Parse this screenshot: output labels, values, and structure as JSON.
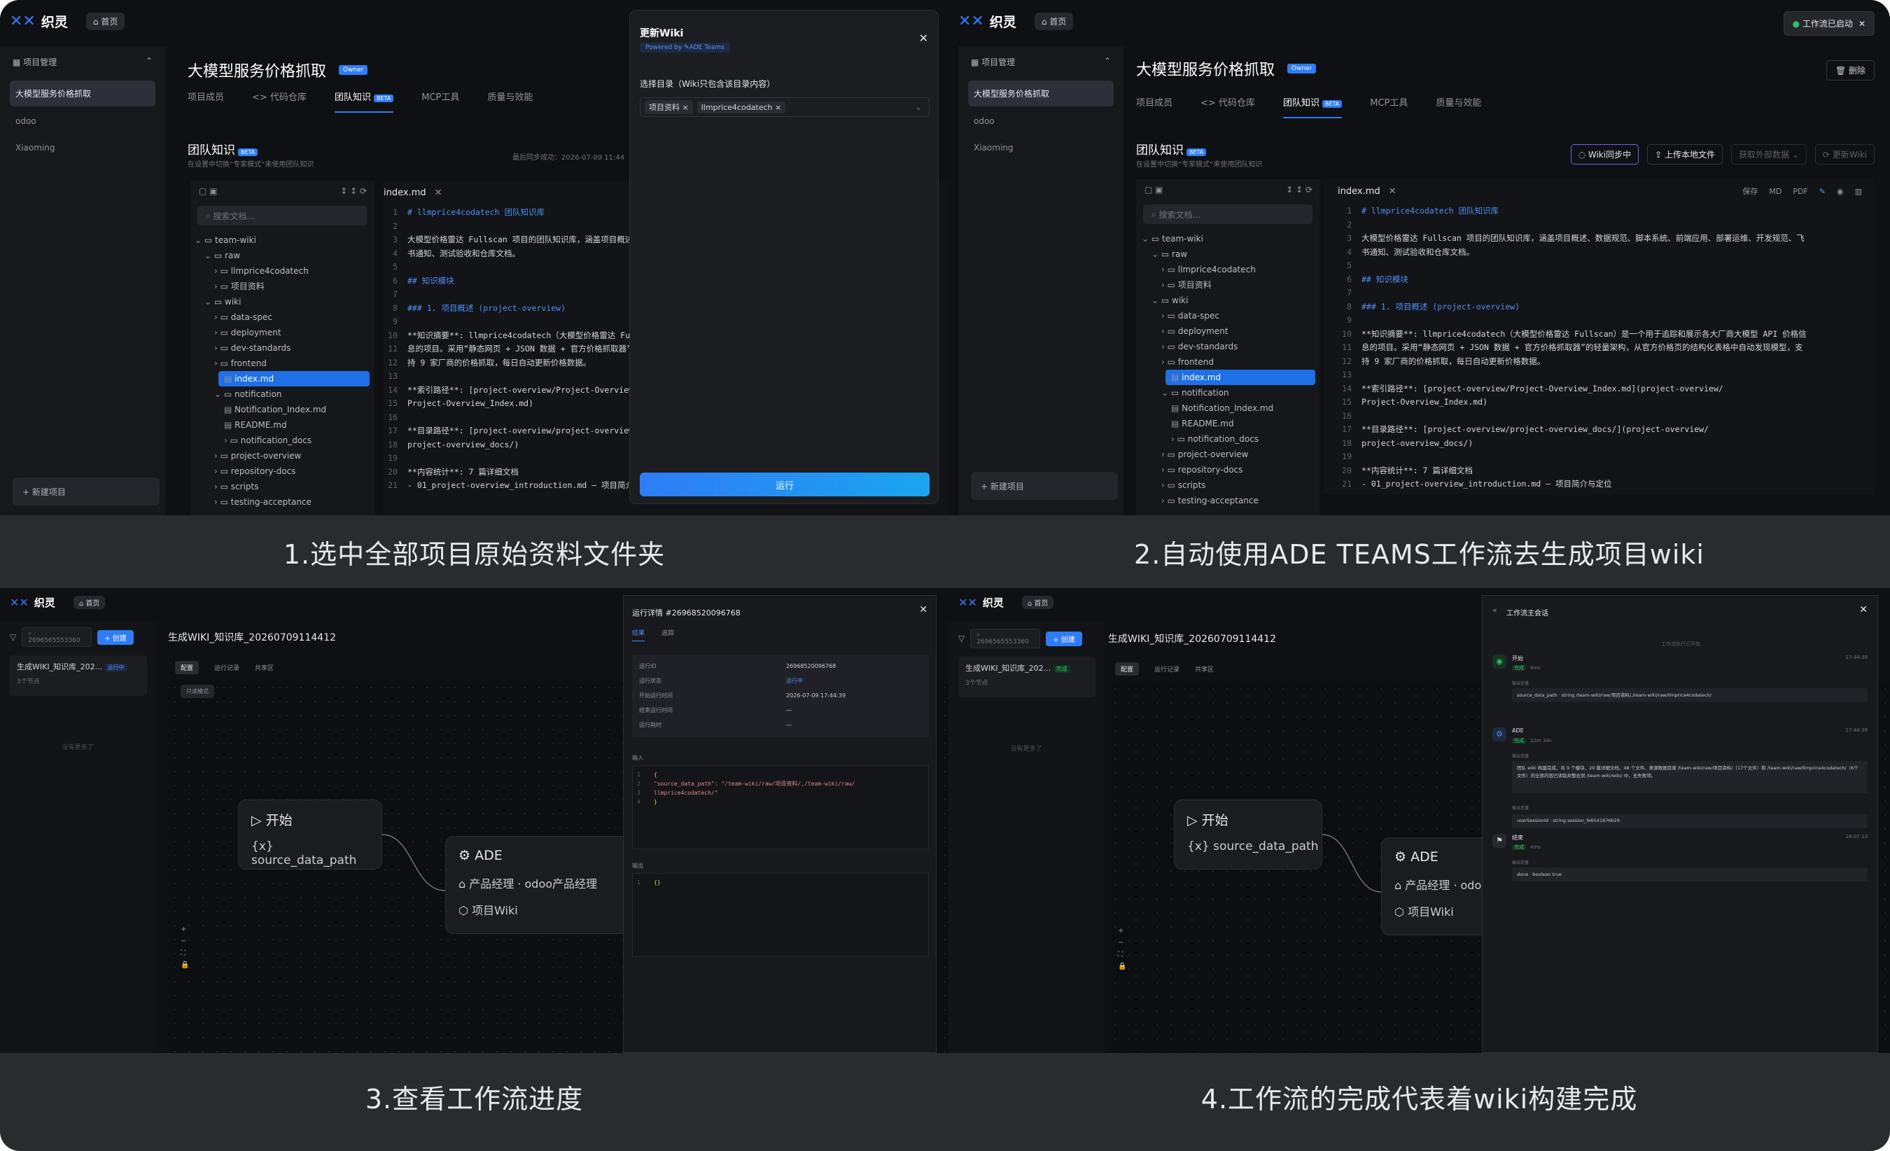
{
  "captions": [
    "1.选中全部项目原始资料文件夹",
    "2.自动使用ADE TEAMS工作流去生成项目wiki",
    "3.查看工作流进度",
    "4.工作流的完成代表着wiki构建完成"
  ],
  "app": {
    "brand": "织灵",
    "home": "首页",
    "sidebar_section": "项目管理",
    "sidebar_items": [
      "大模型服务价格抓取",
      "odoo",
      "Xiaoming"
    ],
    "new_project": "+ 新建项目",
    "project_title": "大模型服务价格抓取",
    "owner_badge": "Owner",
    "tabs": [
      "项目成员",
      "<> 代码仓库",
      "团队知识",
      "MCP工具",
      "质量与效能"
    ],
    "beta": "BETA",
    "kb_title": "团队知识",
    "kb_sub": "在设置中切换“专家模式”来使用团队知识",
    "last_sync": "最后同步成功：2026-07-09 11:44",
    "search_placeholder": "搜索文档...",
    "tree": [
      "team-wiki",
      "raw",
      "llmprice4codatech",
      "项目资料",
      "wiki",
      "data-spec",
      "deployment",
      "dev-standards",
      "frontend",
      "index.md",
      "notification",
      "Notification_Index.md",
      "README.md",
      "notification_docs",
      "project-overview",
      "repository-docs",
      "scripts",
      "testing-acceptance"
    ],
    "editor_tab": "index.md",
    "code": [
      "# llmprice4codatech 团队知识库",
      "",
      "大模型价格雷达 Fullscan 项目的团队知识库，涵盖项目概述、数据规范、脚本系统、前端应用、部署运维、开发规范、飞",
      "书通知、测试验收和仓库文档。",
      "",
      "## 知识模块",
      "",
      "### 1. 项目概述 (project-overview)",
      "",
      "**知识摘要**: llmprice4codatech（大模型价格雷达 Fullscan）是一个用于追踪和展示各大厂商大模型 API 价格信",
      "息的项目。采用“静态网页 + JSON 数据 + 官方价格抓取器”的轻量架构，从官方价格页的结构化表格中自动发现模型，支",
      "持 9 家厂商的价格抓取，每日自动更新价格数据。",
      "",
      "**索引路径**: [project-overview/Project-Overview_Index.md](project-overview/",
      "Project-Overview_Index.md)",
      "",
      "**目录路径**: [project-overview/project-overview_docs/](project-overview/",
      "project-overview_docs/)",
      "",
      "**内容统计**: 7 篇详细文档",
      "- 01_project-overview_introduction.md — 项目简介与定位"
    ]
  },
  "panel1": {
    "modal_title": "更新Wiki",
    "powered": "Powered by ✎ADE Teams",
    "select_label": "选择目录（Wiki只包含该目录内容）",
    "chips": [
      "项目资料",
      "llmprice4codatech"
    ],
    "run": "运行"
  },
  "panel2": {
    "toast": "工作流已启动",
    "delete": "删除",
    "actions": [
      "Wiki同步中",
      "上传本地文件",
      "获取外部数据",
      "更新Wiki"
    ],
    "tools": [
      "保存",
      "MD",
      "PDF"
    ]
  },
  "workflow": {
    "search": "2696565553360",
    "create": "+ 创建",
    "flow_title": "生成WIKI_知识库_20260709114412",
    "list_item": "生成WIKI_知识库_202...",
    "list_sub": "3个节点",
    "status_running": "运行中",
    "status_done": "完成",
    "more": "没有更多了",
    "subtabs": [
      "配置",
      "运行记录",
      "共享区"
    ],
    "canvas_badge": "只读模式",
    "start": "开始",
    "start_param": "{x} source_data_path",
    "ade": "ADE",
    "ade_role": "产品经理 · odoo产品经理",
    "ade_wiki": "项目Wiki"
  },
  "panel3": {
    "title": "运行详情 #26968520096768",
    "tabs": [
      "结果",
      "追踪"
    ],
    "rows": [
      [
        "运行ID",
        "26968520096768"
      ],
      [
        "运行状态",
        "运行中"
      ],
      [
        "开始运行时间",
        "2026-07-09 17:44:39"
      ],
      [
        "结束运行时间",
        "—"
      ],
      [
        "运行耗时",
        "—"
      ]
    ],
    "input_label": "输入",
    "input_code": [
      "{",
      "  \"source_data_path\": \"/team-wiki/raw/项目资料/,/team-wiki/raw/",
      "  llmprice4codatech/\"",
      "}"
    ],
    "output_label": "输出",
    "output_code": [
      "{}"
    ]
  },
  "panel4": {
    "title": "工作流主会话",
    "started": "工作流执行已开始",
    "events": [
      {
        "name": "开始",
        "tag": "完成",
        "dur": "4ms",
        "time": "17:44:39",
        "field": "输出变量",
        "value": "source_data_path · string  /team-wiki/raw/项目资料/,/team-wiki/raw/llmprice4codatech/"
      },
      {
        "name": "ADE",
        "tag": "完成",
        "dur": "22m 34s",
        "time": "17:44:39",
        "field": "输出变量",
        "value": "团队 wiki 构建完成，共 9 个模块，29 篇详细文档，48 个文件。来源数据目录 /team-wiki/raw/项目资料/（17个文件）和 /team-wiki/raw/llmprice4codatech/（6个文件）的全部内容已读取并整合到 /team-wiki/wiki/ 中，无失败项。",
        "value2": "userSessionId · string  session_fe6541876b29"
      },
      {
        "name": "结束",
        "tag": "完成",
        "dur": "4ms",
        "time": "18:07:13",
        "field": "输出变量",
        "value": "done · boolean  true"
      }
    ]
  }
}
